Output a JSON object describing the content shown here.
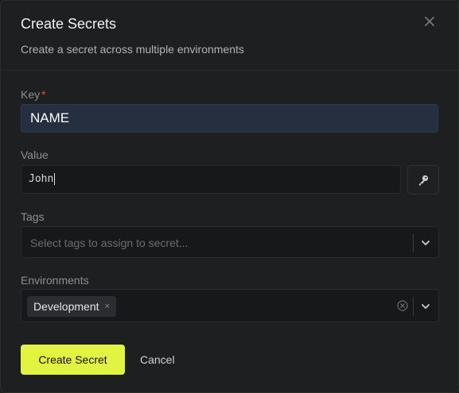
{
  "dialog": {
    "title": "Create Secrets",
    "subtitle": "Create a secret across multiple environments"
  },
  "key_field": {
    "label": "Key",
    "required_mark": "*",
    "value": "NAME"
  },
  "value_field": {
    "label": "Value",
    "value": "John",
    "action_icon": "key-icon"
  },
  "tags_field": {
    "label": "Tags",
    "placeholder": "Select tags to assign to secret..."
  },
  "environments_field": {
    "label": "Environments",
    "selected": [
      {
        "label": "Development",
        "remove_glyph": "×"
      }
    ]
  },
  "actions": {
    "create_label": "Create Secret",
    "cancel_label": "Cancel"
  },
  "colors": {
    "accent": "#e1f442",
    "required": "#e5484d",
    "background": "#1e1f21"
  }
}
